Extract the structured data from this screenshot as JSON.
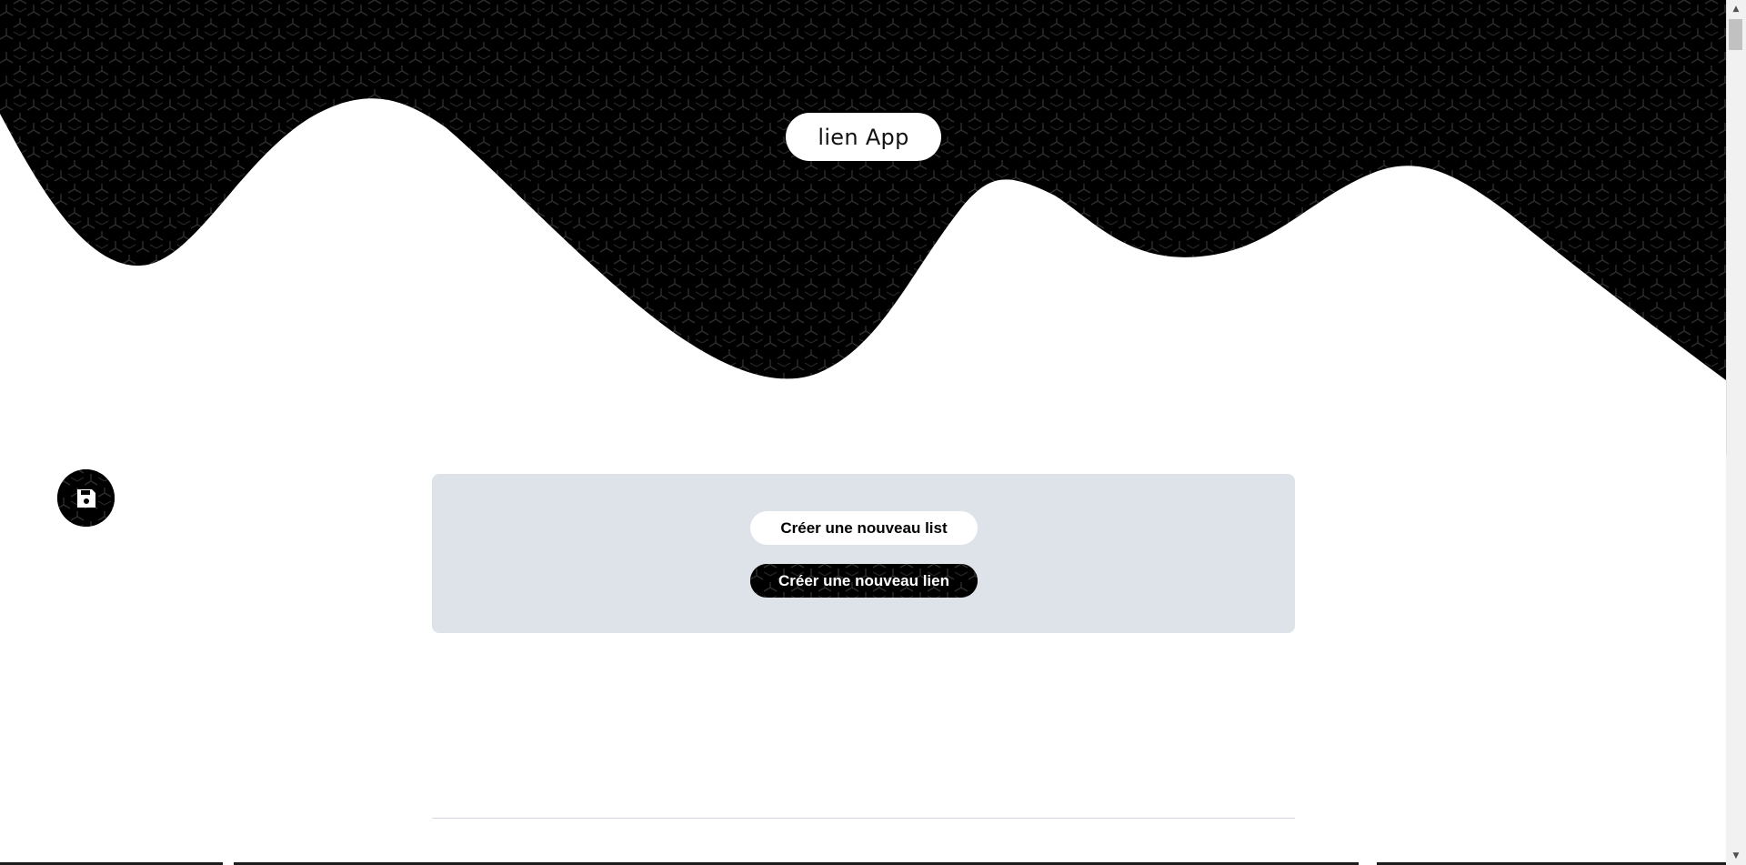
{
  "header": {
    "brand": "lien App"
  },
  "actions": {
    "save_icon": "floppy-disk-icon",
    "create_list_label": "Créer une nouveau list",
    "create_link_label": "Créer une nouveau lien"
  },
  "colors": {
    "hero_background": "#000000",
    "pattern_stroke": "#333333",
    "card_background": "#dee2e9",
    "primary_button": "#000000",
    "secondary_button": "#ffffff"
  }
}
